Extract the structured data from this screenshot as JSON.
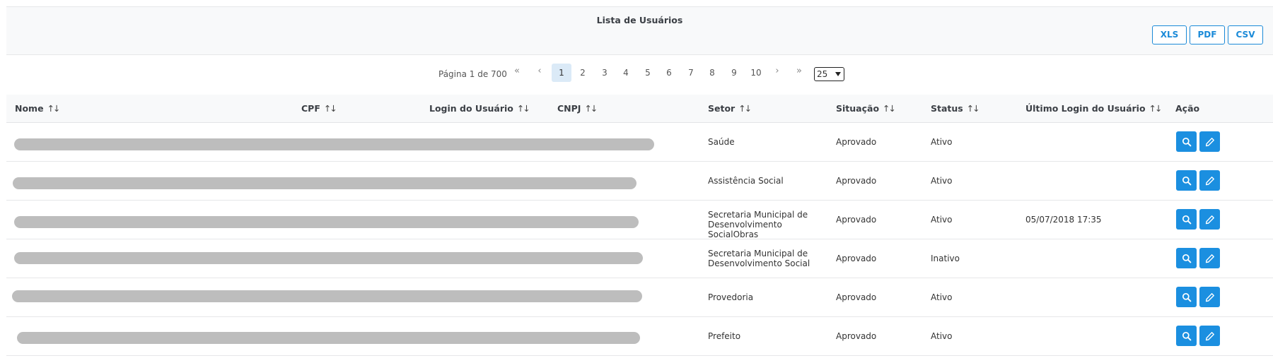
{
  "header": {
    "title": "Lista de Usuários",
    "exports": [
      "XLS",
      "PDF",
      "CSV"
    ]
  },
  "pagination": {
    "info": "Página 1 de 700",
    "first": "«",
    "prev": "‹",
    "pages": [
      "1",
      "2",
      "3",
      "4",
      "5",
      "6",
      "7",
      "8",
      "9",
      "10"
    ],
    "active_page": "1",
    "next": "›",
    "last": "»",
    "page_size": "25"
  },
  "table": {
    "columns": [
      "Nome",
      "CPF",
      "Login do Usuário",
      "CNPJ",
      "Setor",
      "Situação",
      "Status",
      "Último Login do Usuário",
      "Ação"
    ],
    "rows": [
      {
        "setor": "Saúde",
        "situacao": "Aprovado",
        "status": "Ativo",
        "ultimo_login": ""
      },
      {
        "setor": "Assistência Social",
        "situacao": "Aprovado",
        "status": "Ativo",
        "ultimo_login": ""
      },
      {
        "setor": "Secretaria Municipal de Desenvolvimento SocialObras",
        "situacao": "Aprovado",
        "status": "Ativo",
        "ultimo_login": "05/07/2018 17:35"
      },
      {
        "setor": "Secretaria Municipal de Desenvolvimento Social",
        "situacao": "Aprovado",
        "status": "Inativo",
        "ultimo_login": ""
      },
      {
        "setor": "Provedoria",
        "situacao": "Aprovado",
        "status": "Ativo",
        "ultimo_login": ""
      },
      {
        "setor": "Prefeito",
        "situacao": "Aprovado",
        "status": "Ativo",
        "ultimo_login": ""
      }
    ]
  },
  "icons": {
    "view": "search-icon",
    "edit": "pencil-icon",
    "sort": "sort-arrows-icon"
  },
  "colors": {
    "accent": "#1b8fe0",
    "redaction": "#bdbdbd",
    "header_bg": "#f8f9fa"
  }
}
